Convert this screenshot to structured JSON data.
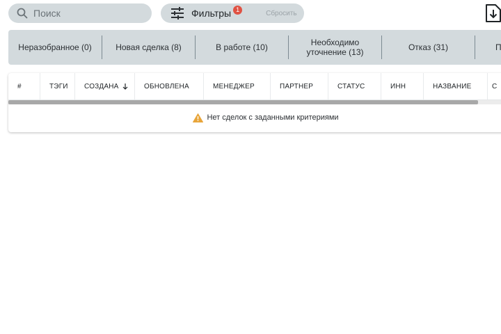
{
  "search": {
    "placeholder": "Поиск"
  },
  "filters": {
    "label": "Фильтры",
    "badge": "1",
    "reset_label": "Сбросить"
  },
  "status_tabs": [
    {
      "label": "Неразобранное (0)"
    },
    {
      "label": "Новая сделка (8)"
    },
    {
      "label": "В работе (10)"
    },
    {
      "label": "Необходимо уточнение (13)"
    },
    {
      "label": "Отказ (31)"
    },
    {
      "label": "П"
    }
  ],
  "table": {
    "columns": [
      "#",
      "ТЭГИ",
      "СОЗДАНА",
      "ОБНОВЛЕНА",
      "МЕНЕДЖЕР",
      "ПАРТНЕР",
      "СТАТУС",
      "ИНН",
      "НАЗВАНИЕ",
      "С"
    ],
    "empty_message": "Нет сделок с заданными критериями"
  },
  "colors": {
    "accent_bg": "#d3dadd",
    "badge": "#e05243",
    "warning": "#e8a53a"
  },
  "icons": {
    "search": "search-icon",
    "filters": "sliders-icon",
    "export": "download-file-icon",
    "sort": "arrow-down-icon",
    "warning": "warning-icon"
  }
}
